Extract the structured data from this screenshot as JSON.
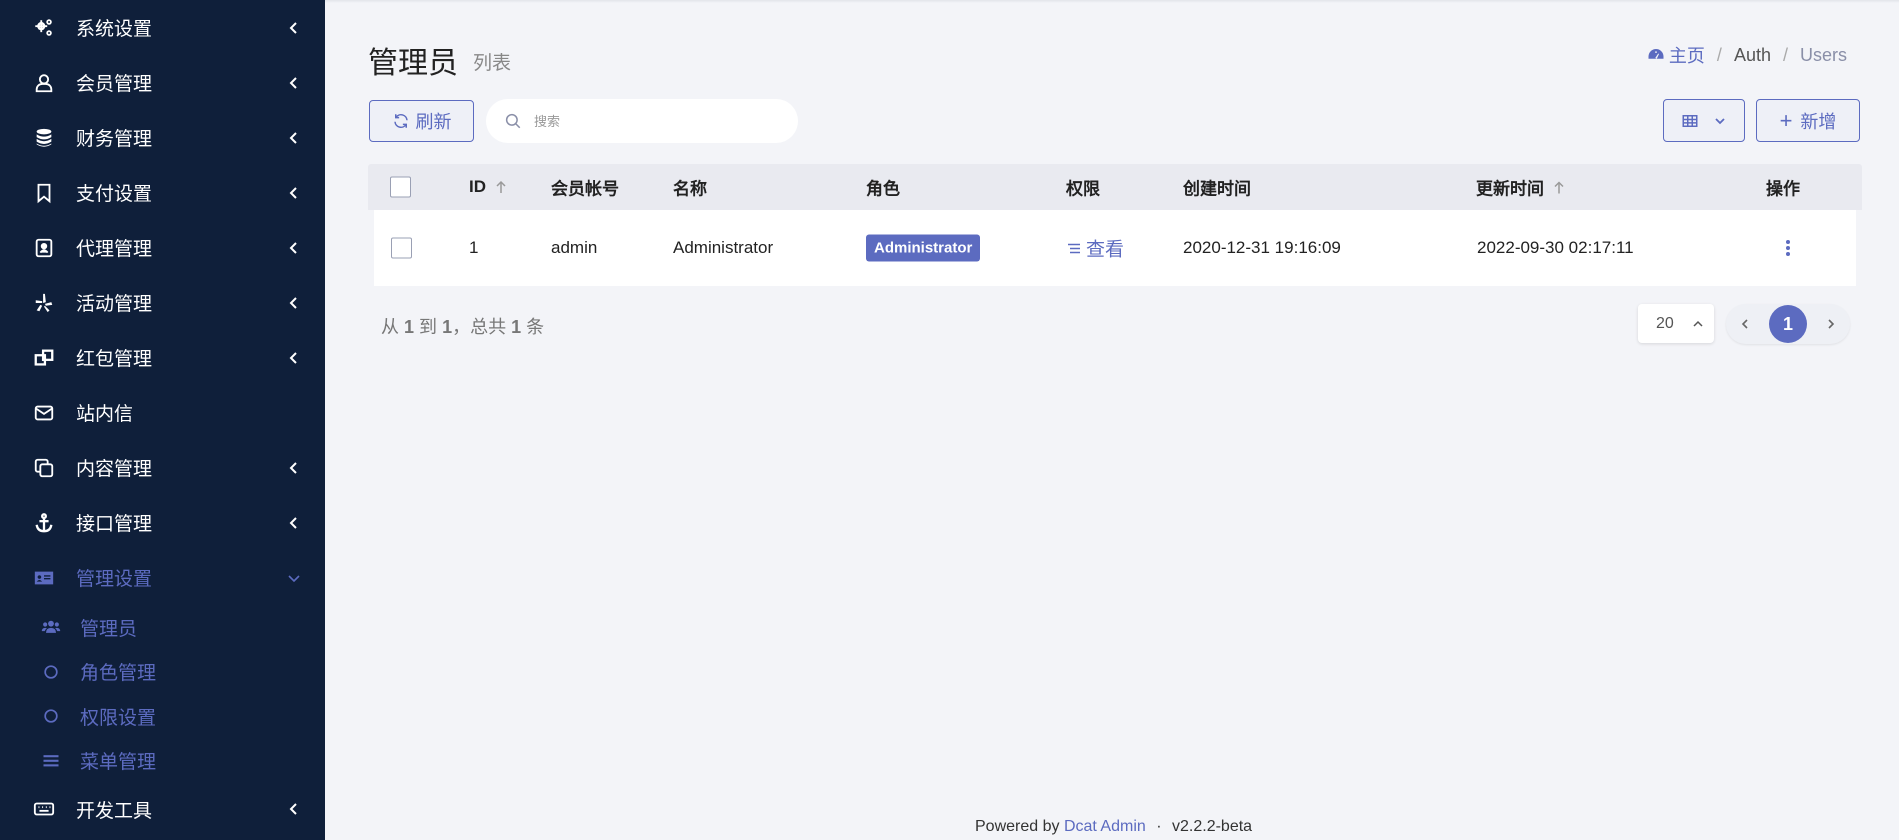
{
  "sidebar": {
    "items": [
      {
        "label": "系统设置",
        "icon": "gears-icon"
      },
      {
        "label": "会员管理",
        "icon": "user-icon"
      },
      {
        "label": "财务管理",
        "icon": "database-icon"
      },
      {
        "label": "支付设置",
        "icon": "bookmark-icon"
      },
      {
        "label": "代理管理",
        "icon": "contact-book-icon"
      },
      {
        "label": "活动管理",
        "icon": "yelp-icon"
      },
      {
        "label": "红包管理",
        "icon": "object-group-icon"
      },
      {
        "label": "站内信",
        "icon": "envelope-icon"
      },
      {
        "label": "内容管理",
        "icon": "clone-icon"
      },
      {
        "label": "接口管理",
        "icon": "anchor-icon"
      },
      {
        "label": "管理设置",
        "icon": "id-card-icon"
      }
    ],
    "sub_items": [
      {
        "label": "管理员",
        "icon": "users-icon"
      },
      {
        "label": "角色管理",
        "icon": "circle-icon"
      },
      {
        "label": "权限设置",
        "icon": "circle-icon"
      },
      {
        "label": "菜单管理",
        "icon": "bars-icon"
      }
    ],
    "dev_tools": {
      "label": "开发工具",
      "icon": "keyboard-icon"
    }
  },
  "header": {
    "title": "管理员",
    "subtitle": "列表",
    "breadcrumb": {
      "home": "主页",
      "auth": "Auth",
      "users": "Users",
      "separator": "/"
    }
  },
  "toolbar": {
    "refresh_label": "刷新",
    "search_placeholder": "搜索",
    "new_label": "新增",
    "new_plus": "+"
  },
  "table": {
    "columns": {
      "id": "ID",
      "account": "会员帐号",
      "name": "名称",
      "role": "角色",
      "permission": "权限",
      "created": "创建时间",
      "updated": "更新时间",
      "actions": "操作"
    },
    "rows": [
      {
        "id": "1",
        "account": "admin",
        "name": "Administrator",
        "role": "Administrator",
        "permission": "查看",
        "created": "2020-12-31 19:16:09",
        "updated": "2022-09-30 02:17:11"
      }
    ]
  },
  "pagination": {
    "summary_from": "从",
    "summary_from_val": "1",
    "summary_to": "到",
    "summary_to_val": "1",
    "summary_total": "，总共",
    "summary_total_val": "1",
    "summary_unit": "条",
    "per_page": "20",
    "current_page": "1"
  },
  "footer": {
    "powered": "Powered by",
    "brand": "Dcat Admin",
    "dot": "·",
    "version": "v2.2.2-beta"
  },
  "colors": {
    "sidebar_bg": "#0f1f3a",
    "accent": "#5c6bc0",
    "page_bg": "#f3f4f8"
  }
}
